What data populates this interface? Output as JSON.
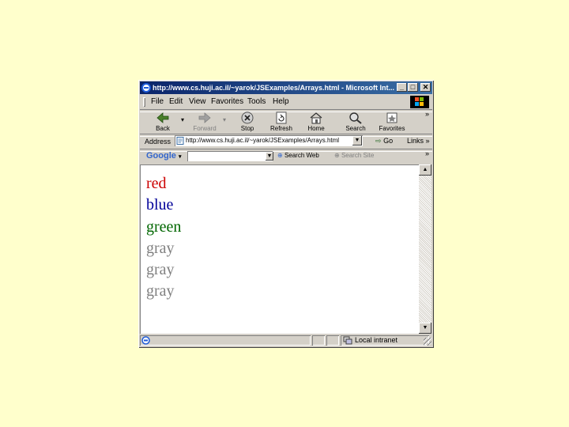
{
  "window": {
    "title": "http://www.cs.huji.ac.il/~yarok/JSExamples/Arrays.html - Microsoft Int...",
    "minimize_label": "_",
    "maximize_label": "□",
    "close_label": "✕"
  },
  "menubar": {
    "items": [
      {
        "label": "File"
      },
      {
        "label": "Edit"
      },
      {
        "label": "View"
      },
      {
        "label": "Favorites"
      },
      {
        "label": "Tools"
      },
      {
        "label": "Help"
      }
    ]
  },
  "toolbar": {
    "back_label": "Back",
    "forward_label": "Forward",
    "stop_label": "Stop",
    "refresh_label": "Refresh",
    "home_label": "Home",
    "search_label": "Search",
    "favorites_label": "Favorites",
    "more_label": "»"
  },
  "address": {
    "label": "Address",
    "url": "http://www.cs.huji.ac.il/~yarok/JSExamples/Arrays.html",
    "go_label": "Go",
    "links_label": "Links »"
  },
  "googlebar": {
    "logo": "Google",
    "search_input": "",
    "search_web_label": "Search Web",
    "search_site_label": "Search Site",
    "more_label": "»"
  },
  "content": {
    "lines": [
      {
        "text": "red",
        "color": "#cc0000"
      },
      {
        "text": "blue",
        "color": "#000099"
      },
      {
        "text": "green",
        "color": "#006600"
      },
      {
        "text": "gray",
        "color": "#808080"
      },
      {
        "text": "gray",
        "color": "#808080"
      },
      {
        "text": "gray",
        "color": "#808080"
      }
    ]
  },
  "statusbar": {
    "zone_label": "Local intranet"
  },
  "icons": {
    "title": "ie-icon",
    "back": "back-arrow-icon",
    "forward": "forward-arrow-icon",
    "stop": "stop-icon",
    "refresh": "refresh-icon",
    "home": "home-icon",
    "search": "search-icon",
    "favorites": "favorites-icon"
  }
}
